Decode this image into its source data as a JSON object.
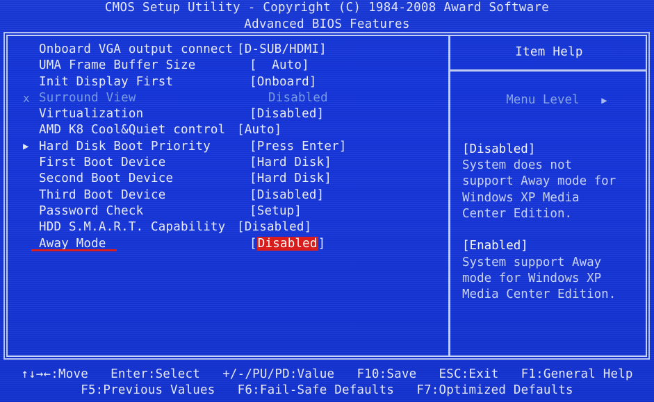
{
  "header": {
    "title": "CMOS Setup Utility - Copyright (C) 1984-2008 Award Software",
    "subtitle": "Advanced BIOS Features"
  },
  "options": [
    {
      "marker": "",
      "label": "Onboard VGA output connect",
      "value": "[D-SUB/HDMI]",
      "dim": false,
      "tight": true,
      "highlight": false,
      "underline": false
    },
    {
      "marker": "",
      "label": "UMA Frame Buffer Size",
      "value": "[  Auto]",
      "dim": false,
      "tight": false,
      "highlight": false,
      "underline": false
    },
    {
      "marker": "",
      "label": "Init Display First",
      "value": "[Onboard]",
      "dim": false,
      "tight": false,
      "highlight": false,
      "underline": false
    },
    {
      "marker": "x",
      "label": "Surround View",
      "value": "Disabled",
      "dim": true,
      "tight": false,
      "highlight": false,
      "underline": false
    },
    {
      "marker": "",
      "label": "Virtualization",
      "value": "[Disabled]",
      "dim": false,
      "tight": false,
      "highlight": false,
      "underline": false
    },
    {
      "marker": "",
      "label": "AMD K8 Cool&Quiet control",
      "value": "[Auto]",
      "dim": false,
      "tight": true,
      "highlight": false,
      "underline": false
    },
    {
      "marker": "▶",
      "label": "Hard Disk Boot Priority",
      "value": "[Press Enter]",
      "dim": false,
      "tight": false,
      "highlight": false,
      "underline": false
    },
    {
      "marker": "",
      "label": "First Boot Device",
      "value": "[Hard Disk]",
      "dim": false,
      "tight": false,
      "highlight": false,
      "underline": false
    },
    {
      "marker": "",
      "label": "Second Boot Device",
      "value": "[Hard Disk]",
      "dim": false,
      "tight": false,
      "highlight": false,
      "underline": false
    },
    {
      "marker": "",
      "label": "Third Boot Device",
      "value": "[Disabled]",
      "dim": false,
      "tight": false,
      "highlight": false,
      "underline": false
    },
    {
      "marker": "",
      "label": "Password Check",
      "value": "[Setup]",
      "dim": false,
      "tight": false,
      "highlight": false,
      "underline": false
    },
    {
      "marker": "",
      "label": "HDD S.M.A.R.T. Capability",
      "value": "[Disabled]",
      "dim": false,
      "tight": true,
      "highlight": false,
      "underline": false
    },
    {
      "marker": "",
      "label": "Away Mode",
      "value": "Disabled",
      "dim": false,
      "tight": false,
      "highlight": true,
      "underline": true
    }
  ],
  "help": {
    "title": "Item Help",
    "menu_level_label": "Menu Level",
    "menu_level_arrow": "▶",
    "blocks": [
      {
        "head": "[Disabled]",
        "lines": [
          "System does not",
          "support Away mode for",
          "Windows XP Media",
          "Center Edition."
        ]
      },
      {
        "head": "[Enabled]",
        "lines": [
          "System support Away",
          "mode for Windows XP",
          "Media Center Edition."
        ]
      }
    ]
  },
  "footer": {
    "line1": "↑↓→←:Move   Enter:Select   +/-/PU/PD:Value   F10:Save   ESC:Exit   F1:General Help",
    "line2": "F5:Previous Values   F6:Fail-Safe Defaults   F7:Optimized Defaults"
  },
  "colors": {
    "background": "#1535d8",
    "text": "#eef1ff",
    "dim_text": "#7b9ee8",
    "border": "#c7d2fa",
    "highlight": "#e01b1b"
  }
}
